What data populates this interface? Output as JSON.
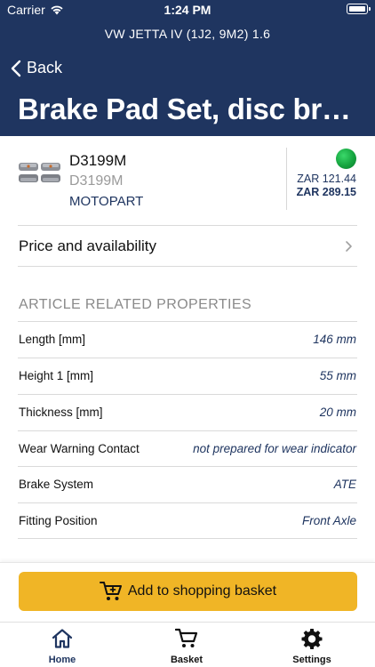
{
  "status_bar": {
    "carrier": "Carrier",
    "time": "1:24 PM"
  },
  "header": {
    "vehicle": "VW JETTA IV (1J2, 9M2) 1.6",
    "back_label": "Back",
    "title": "Brake Pad Set, disc brake"
  },
  "product": {
    "code": "D3199M",
    "code_alt": "D3199M",
    "brand": "MOTOPART",
    "availability_color": "#1aa744",
    "price_1": "ZAR 121.44",
    "price_2": "ZAR 289.15"
  },
  "price_availability": {
    "label": "Price and availability"
  },
  "properties": {
    "section_title": "ARTICLE RELATED PROPERTIES",
    "items": [
      {
        "label": "Length [mm]",
        "value": "146 mm"
      },
      {
        "label": "Height 1 [mm]",
        "value": "55 mm"
      },
      {
        "label": "Thickness [mm]",
        "value": "20 mm"
      },
      {
        "label": "Wear Warning Contact",
        "value": "not prepared for wear indicator"
      },
      {
        "label": "Brake System",
        "value": "ATE"
      },
      {
        "label": "Fitting Position",
        "value": "Front Axle"
      }
    ]
  },
  "actions": {
    "add_to_basket": "Add to shopping basket"
  },
  "tabbar": {
    "items": [
      {
        "label": "Home",
        "icon": "home-icon",
        "active": true
      },
      {
        "label": "Basket",
        "icon": "cart-icon",
        "active": false
      },
      {
        "label": "Settings",
        "icon": "gear-icon",
        "active": false
      }
    ]
  },
  "colors": {
    "header": "#1f3560",
    "accent": "#f0b526",
    "available": "#1aa744"
  }
}
